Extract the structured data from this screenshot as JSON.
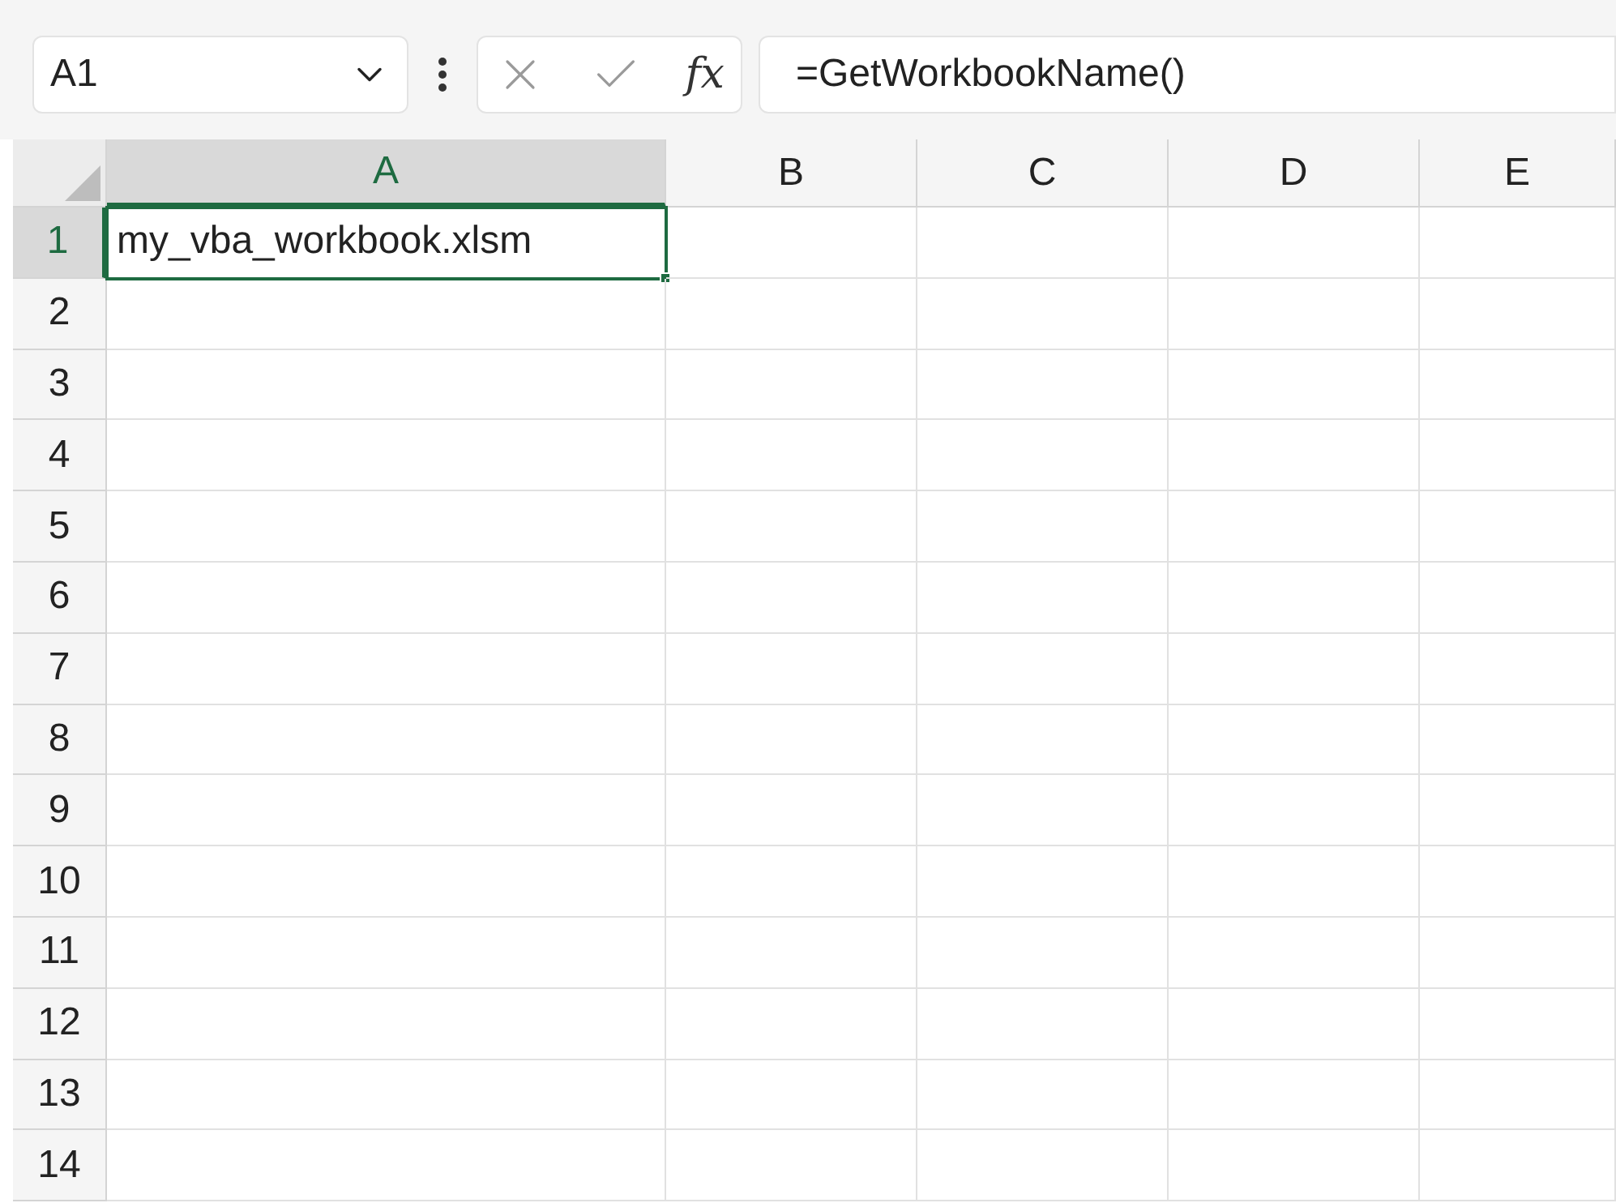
{
  "name_box": {
    "value": "A1"
  },
  "formula_bar": {
    "fx": "fx",
    "value": "=GetWorkbookName()"
  },
  "columns": [
    {
      "label": "A",
      "selected": true
    },
    {
      "label": "B",
      "selected": false
    },
    {
      "label": "C",
      "selected": false
    },
    {
      "label": "D",
      "selected": false
    },
    {
      "label": "E",
      "selected": false
    }
  ],
  "rows": [
    {
      "label": "1",
      "selected": true,
      "cells": [
        {
          "text": "my_vba_workbook.xlsm",
          "selected": true
        }
      ]
    },
    {
      "label": "2",
      "selected": false
    },
    {
      "label": "3",
      "selected": false
    },
    {
      "label": "4",
      "selected": false
    },
    {
      "label": "5",
      "selected": false
    },
    {
      "label": "6",
      "selected": false
    },
    {
      "label": "7",
      "selected": false
    },
    {
      "label": "8",
      "selected": false
    },
    {
      "label": "9",
      "selected": false
    },
    {
      "label": "10",
      "selected": false
    },
    {
      "label": "11",
      "selected": false
    },
    {
      "label": "12",
      "selected": false
    },
    {
      "label": "13",
      "selected": false
    },
    {
      "label": "14",
      "selected": false
    }
  ]
}
